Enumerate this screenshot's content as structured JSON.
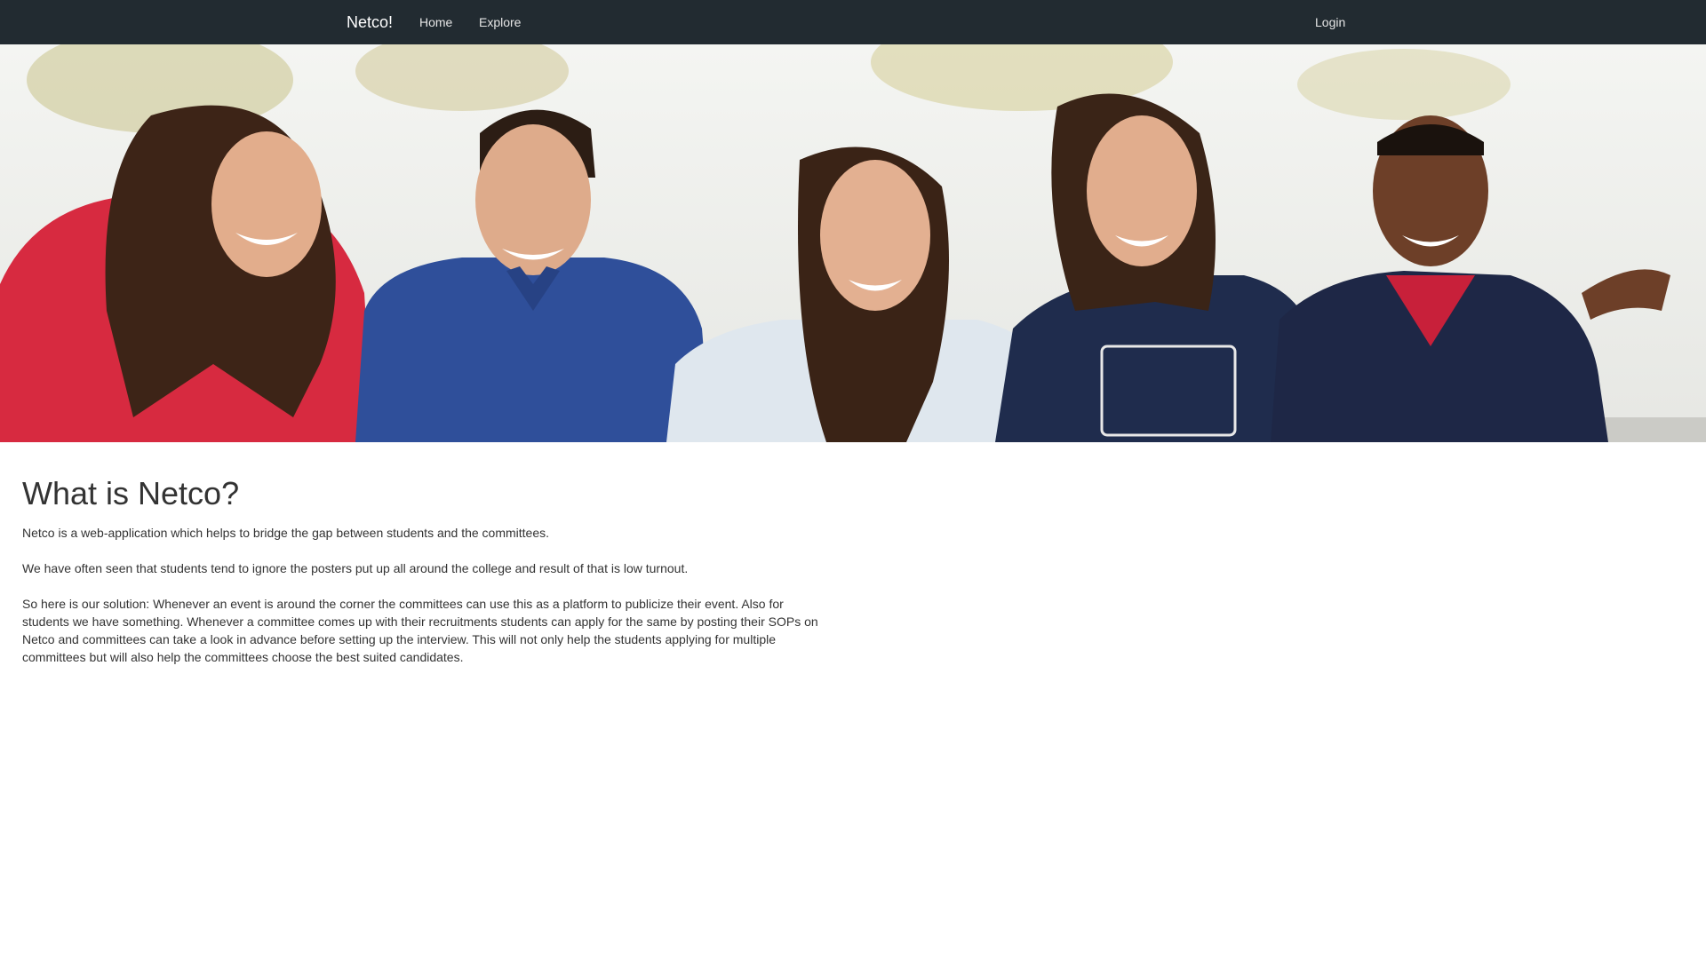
{
  "navbar": {
    "brand": "Netco!",
    "links": [
      {
        "label": "Home"
      },
      {
        "label": "Explore"
      }
    ],
    "login_label": "Login"
  },
  "hero": {
    "image_description_icon": "group-photo-image",
    "colors": {
      "sky": "#f3f4f2",
      "red_shirt": "#d8283f",
      "blue_shirt": "#2f4f9a",
      "white_shirt": "#dfe7ee",
      "navy_tshirt": "#1f2c4d",
      "navy_polo": "#1e2746",
      "hair": "#3b2418",
      "skin_light": "#e0ab8a",
      "skin_dark": "#6b3f28"
    }
  },
  "main": {
    "heading": "What is Netco?",
    "paragraphs": [
      "Netco is a web-application which helps to bridge the gap between students and the committees.",
      "We have often seen that students tend to ignore the posters put up all around the college and result of that is low turnout.",
      "So here is our solution: Whenever an event is around the corner the committees can use this as a platform to publicize their event. Also for students we have something. Whenever a committee comes up with their recruitments students can apply for the same by posting their SOPs on Netco and committees can take a look in advance before setting up the interview. This will not only help the students applying for multiple committees but will also help the committees choose the best suited candidates."
    ]
  }
}
